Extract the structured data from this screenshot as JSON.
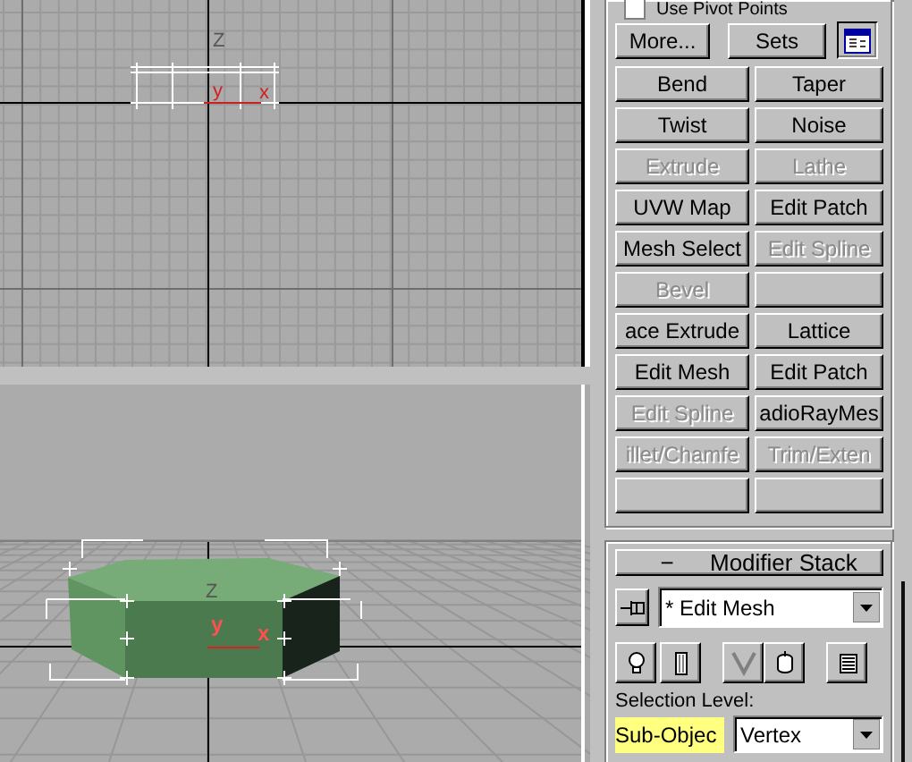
{
  "viewports": [
    {
      "kind": "front",
      "axis_labels": [
        "Z",
        "y",
        "x"
      ]
    },
    {
      "kind": "perspective",
      "axis_labels": [
        "Z",
        "y",
        "x"
      ]
    }
  ],
  "panel": {
    "use_pivot": {
      "label": "Use Pivot Points",
      "checked": false
    },
    "more_button": "More...",
    "sets_button": "Sets",
    "modifier_buttons": [
      {
        "label": "Bend",
        "disabled": false
      },
      {
        "label": "Taper",
        "disabled": false
      },
      {
        "label": "Twist",
        "disabled": false
      },
      {
        "label": "Noise",
        "disabled": false
      },
      {
        "label": "Extrude",
        "disabled": true
      },
      {
        "label": "Lathe",
        "disabled": true
      },
      {
        "label": "UVW Map",
        "disabled": false
      },
      {
        "label": "Edit Patch",
        "disabled": false
      },
      {
        "label": "Mesh Select",
        "disabled": false
      },
      {
        "label": "Edit Spline",
        "disabled": true
      },
      {
        "label": "Bevel",
        "disabled": true
      },
      {
        "kind": "blank"
      },
      {
        "label": "ace Extrude",
        "disabled": false
      },
      {
        "label": "Lattice",
        "disabled": false
      },
      {
        "label": "Edit Mesh",
        "disabled": false
      },
      {
        "label": "Edit Patch",
        "disabled": false
      },
      {
        "label": "Edit Spline",
        "disabled": true
      },
      {
        "label": "adioRayMes",
        "disabled": false
      },
      {
        "label": "illet/Chamfe",
        "disabled": true
      },
      {
        "label": "Trim/Exten",
        "disabled": true
      },
      {
        "kind": "blank"
      },
      {
        "kind": "blank"
      }
    ],
    "modifier_stack": {
      "title": "Modifier Stack",
      "collapse": "−",
      "current": "* Edit Mesh",
      "selection_level_label": "Selection Level:",
      "sub_object": {
        "label": "Sub-Objec",
        "on": true
      },
      "level_value": "Vertex"
    }
  }
}
